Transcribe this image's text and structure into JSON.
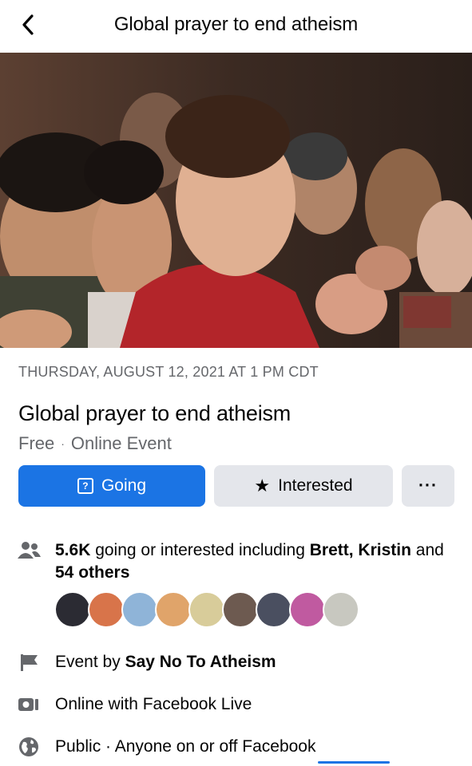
{
  "header": {
    "back_icon": "chevron-left-icon",
    "title": "Global prayer to end atheism"
  },
  "event": {
    "date": "THURSDAY, AUGUST 12, 2021 AT 1 PM CDT",
    "title": "Global prayer to end atheism",
    "price": "Free",
    "separator": "·",
    "type": "Online Event"
  },
  "actions": {
    "going_label": "Going",
    "going_icon": "question-calendar-icon",
    "interested_label": "Interested",
    "interested_icon": "star-icon",
    "more_label": "···"
  },
  "details": {
    "attendees_count": "5.6K",
    "attendees_text": "going or interested including",
    "attendees_names": "Brett, Kristin",
    "attendees_and": "and",
    "attendees_others": "54 others",
    "avatar_count": 9,
    "host_prefix": "Event by",
    "host_name": "Say No To Atheism",
    "online_text": "Online with Facebook Live",
    "privacy_text": "Public · Anyone on or off Facebook"
  },
  "colors": {
    "primary": "#1b74e4",
    "secondary_button": "#e4e6eb",
    "muted_text": "#65676b"
  }
}
